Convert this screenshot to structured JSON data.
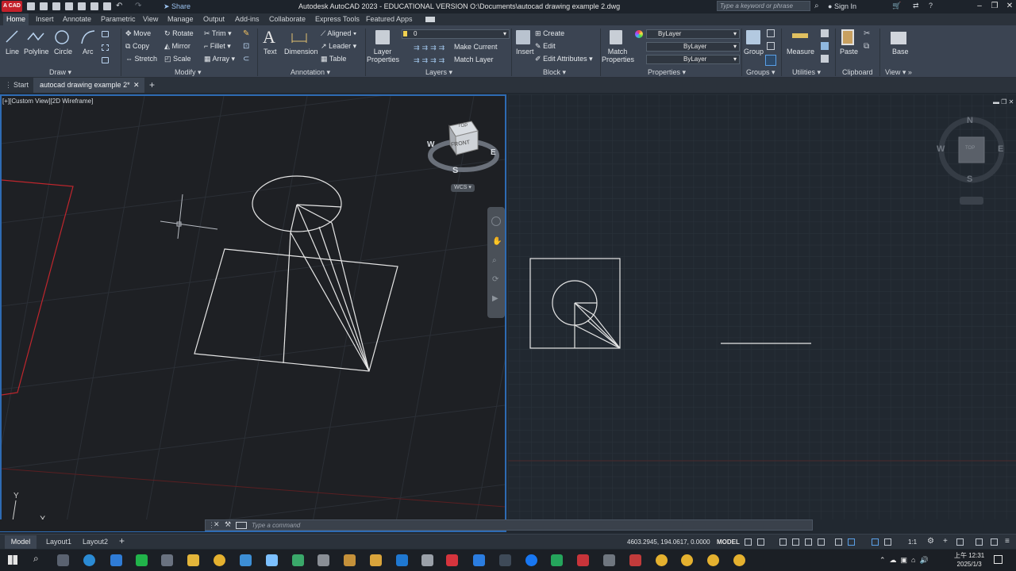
{
  "titlebar": {
    "logo": "A CAD",
    "title": "Autodesk AutoCAD 2023 - EDUCATIONAL VERSION     O:\\Documents\\autocad drawing example 2.dwg",
    "share": "Share",
    "search_placeholder": "Type a keyword or phrase",
    "sign_in": "Sign In"
  },
  "ribbon_tabs": [
    "Home",
    "Insert",
    "Annotate",
    "Parametric",
    "View",
    "Manage",
    "Output",
    "Add-ins",
    "Collaborate",
    "Express Tools",
    "Featured Apps"
  ],
  "ribbon": {
    "draw": {
      "title": "Draw",
      "line": "Line",
      "polyline": "Polyline",
      "circle": "Circle",
      "arc": "Arc"
    },
    "modify": {
      "title": "Modify",
      "move": "Move",
      "rotate": "Rotate",
      "trim": "Trim",
      "copy": "Copy",
      "mirror": "Mirror",
      "fillet": "Fillet",
      "stretch": "Stretch",
      "scale": "Scale",
      "array": "Array"
    },
    "annotation": {
      "title": "Annotation",
      "text": "Text",
      "dimension": "Dimension",
      "aligned": "Aligned",
      "leader": "Leader",
      "table": "Table"
    },
    "layers": {
      "title": "Layers",
      "layer_properties": "Layer Properties",
      "current_layer": "0",
      "make_current": "Make Current",
      "match_layer": "Match Layer"
    },
    "block": {
      "title": "Block",
      "insert": "Insert",
      "create": "Create",
      "edit": "Edit",
      "edit_attributes": "Edit Attributes"
    },
    "properties": {
      "title": "Properties",
      "match_properties": "Match Properties",
      "color": "ByLayer",
      "lineweight": "ByLayer",
      "linetype": "ByLayer"
    },
    "groups": {
      "title": "Groups",
      "group": "Group"
    },
    "utilities": {
      "title": "Utilities",
      "measure": "Measure"
    },
    "clipboard": {
      "title": "Clipboard",
      "paste": "Paste"
    },
    "view": {
      "title": "View",
      "base": "Base"
    }
  },
  "doc_tabs": {
    "start": "Start",
    "active": "autocad drawing example 2*"
  },
  "viewport_left": {
    "label": "[+][Custom View][2D Wireframe]",
    "viewcube_top": "TOP",
    "viewcube_front": "FRONT",
    "compass": {
      "n": "N",
      "s": "S",
      "e": "E",
      "w": "W"
    },
    "wcs": "WCS",
    "ucs_x": "X",
    "ucs_y": "Y"
  },
  "viewport_right": {
    "compass": {
      "n": "N",
      "s": "S",
      "e": "E",
      "w": "W"
    },
    "viewcube_top": "TOP"
  },
  "command_line": {
    "placeholder": "Type a command"
  },
  "layout_tabs": [
    "Model",
    "Layout1",
    "Layout2"
  ],
  "status": {
    "coords": "4603.2945, 194.0617, 0.0000",
    "model": "MODEL",
    "scale": "1:1"
  },
  "clock": {
    "time": "上午 12:31",
    "date": "2025/1/3"
  }
}
